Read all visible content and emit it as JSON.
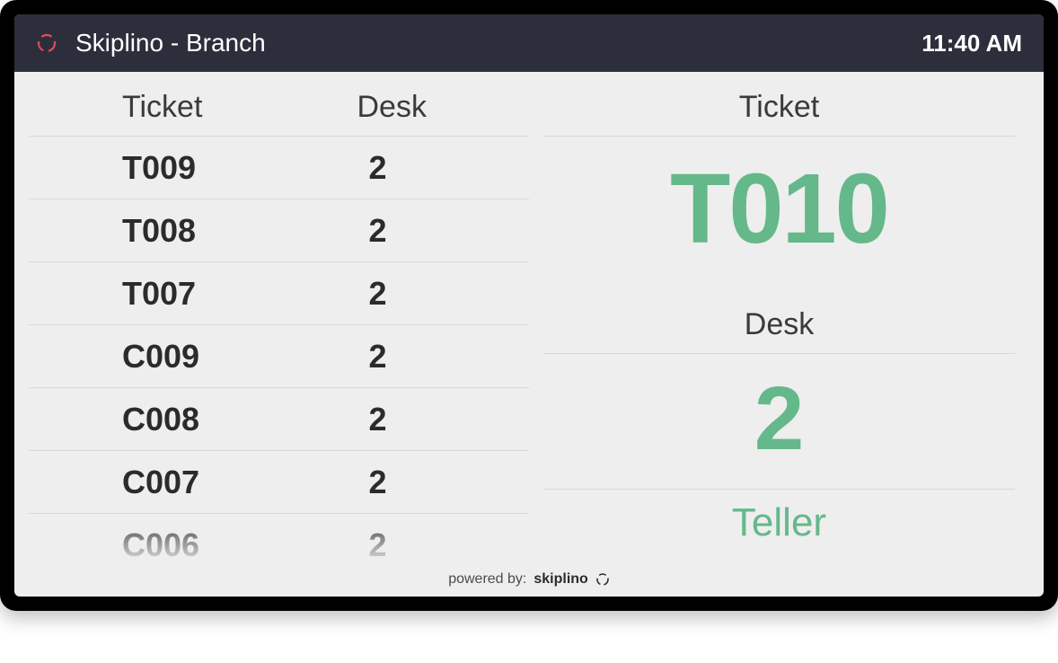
{
  "header": {
    "title": "Skiplino - Branch",
    "time": "11:40 AM"
  },
  "left": {
    "cols": {
      "ticket": "Ticket",
      "desk": "Desk"
    },
    "queue": [
      {
        "ticket": "T009",
        "desk": "2"
      },
      {
        "ticket": "T008",
        "desk": "2"
      },
      {
        "ticket": "T007",
        "desk": "2"
      },
      {
        "ticket": "C009",
        "desk": "2"
      },
      {
        "ticket": "C008",
        "desk": "2"
      },
      {
        "ticket": "C007",
        "desk": "2"
      },
      {
        "ticket": "C006",
        "desk": "2"
      }
    ]
  },
  "right": {
    "ticket_label": "Ticket",
    "ticket_value": "T010",
    "desk_label": "Desk",
    "desk_value": "2",
    "role": "Teller"
  },
  "footer": {
    "powered_by": "powered by:",
    "brand": "skiplino"
  },
  "colors": {
    "header_bg": "#2c2e3b",
    "accent": "#65b88a",
    "screen_bg": "#eeeeee",
    "text_dark": "#2b2b2b"
  }
}
